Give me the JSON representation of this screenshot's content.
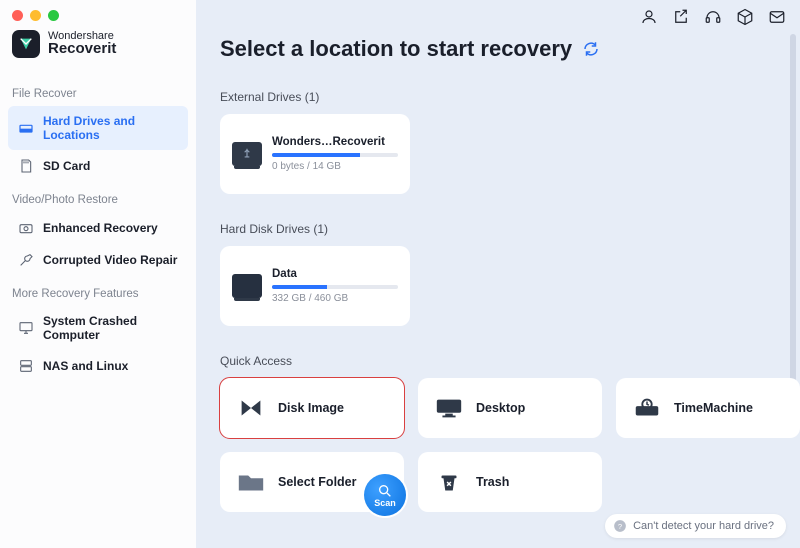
{
  "brand": {
    "line1": "Wondershare",
    "line2": "Recoverit"
  },
  "sidebar": {
    "sections": [
      {
        "title": "File Recover",
        "items": [
          {
            "label": "Hard Drives and Locations",
            "active": true
          },
          {
            "label": "SD Card"
          }
        ]
      },
      {
        "title": "Video/Photo Restore",
        "items": [
          {
            "label": "Enhanced Recovery"
          },
          {
            "label": "Corrupted Video Repair"
          }
        ]
      },
      {
        "title": "More Recovery Features",
        "items": [
          {
            "label": "System Crashed Computer"
          },
          {
            "label": "NAS and Linux"
          }
        ]
      }
    ]
  },
  "main": {
    "title": "Select a location to start recovery",
    "external_label": "External Drives (1)",
    "external_drive": {
      "name": "Wonders…Recoverit",
      "capacity": "0 bytes / 14 GB",
      "fill_pct": 70
    },
    "hdd_label": "Hard Disk Drives (1)",
    "hdd_drive": {
      "name": "Data",
      "capacity": "332 GB / 460 GB",
      "fill_pct": 44
    },
    "quick_label": "Quick Access",
    "quick": {
      "disk_image": "Disk Image",
      "desktop": "Desktop",
      "timemachine": "TimeMachine",
      "select_folder": "Select Folder",
      "trash": "Trash",
      "scan": "Scan"
    },
    "help": "Can't detect your hard drive?"
  }
}
